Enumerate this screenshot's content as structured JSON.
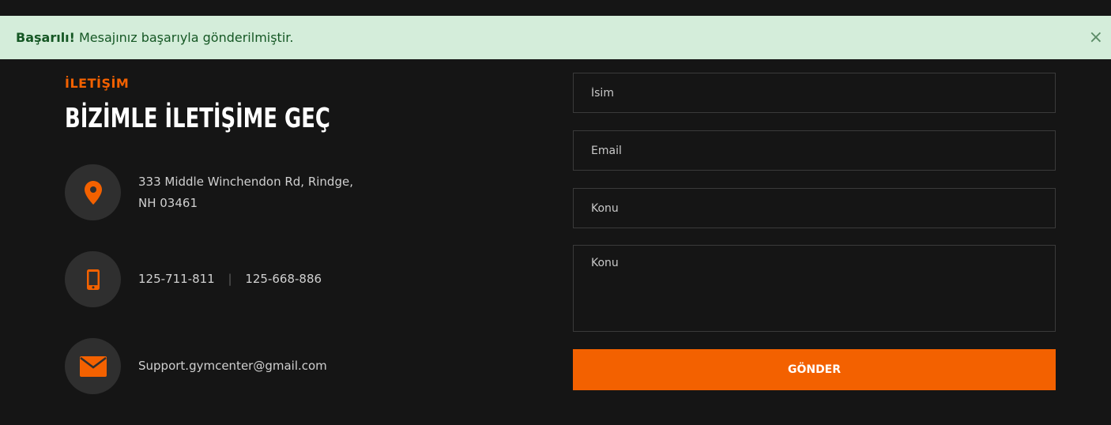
{
  "alert": {
    "strong": "Başarılı!",
    "message": "Mesajınız başarıyla gönderilmiştir.",
    "close": "×"
  },
  "contact": {
    "eyebrow": "İLETİŞİM",
    "title": "BİZİMLE İLETİŞİME GEÇ",
    "address_line1": "333 Middle Winchendon Rd, Rindge,",
    "address_line2": "NH 03461",
    "phone1": "125-711-811",
    "phone_separator": "|",
    "phone2": "125-668-886",
    "email": "Support.gymcenter@gmail.com"
  },
  "form": {
    "name_placeholder": "İsim",
    "email_placeholder": "Email",
    "subject_placeholder": "Konu",
    "message_placeholder": "Konu",
    "submit_label": "GÖNDER"
  },
  "colors": {
    "accent": "#f36100",
    "background": "#151515",
    "alert_bg": "#d4edda",
    "alert_text": "#155724"
  },
  "icons": {
    "address": "map-pin-icon",
    "phone": "mobile-phone-icon",
    "email": "envelope-icon"
  }
}
